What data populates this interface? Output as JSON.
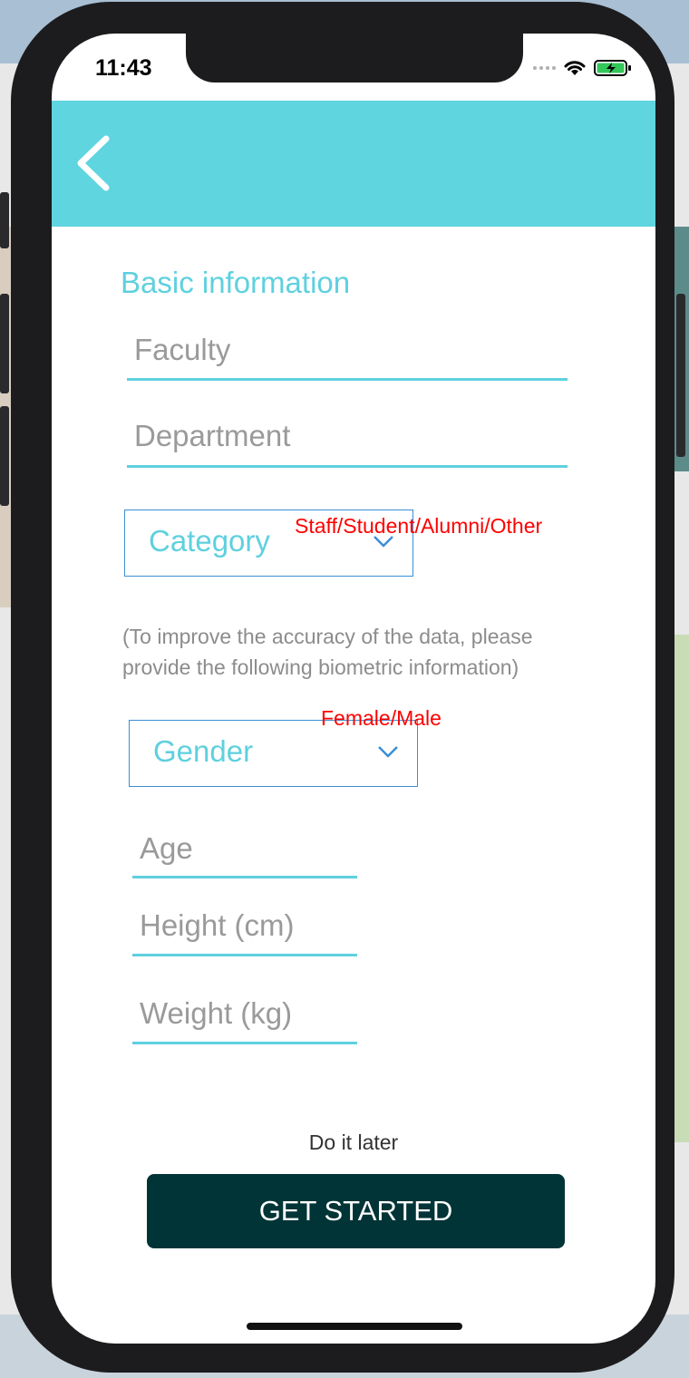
{
  "status_bar": {
    "time": "11:43"
  },
  "form": {
    "section_title": "Basic information",
    "faculty_placeholder": "Faculty",
    "department_placeholder": "Department",
    "category_label": "Category",
    "category_note": "Staff/Student/Alumni/Other",
    "biometric_note": "(To improve the accuracy of the data, please provide the following biometric information)",
    "gender_label": "Gender",
    "gender_note": "Female/Male",
    "age_placeholder": "Age",
    "height_placeholder": "Height (cm)",
    "weight_placeholder": "Weight (kg)"
  },
  "actions": {
    "later_label": "Do it later",
    "start_label": "GET STARTED"
  },
  "colors": {
    "accent": "#5fd5e0",
    "button": "#003436",
    "annotation": "#ff0000"
  },
  "icons": [
    "back-chevron-icon",
    "chevron-down-icon",
    "wifi-icon",
    "battery-icon",
    "signal-dots-icon"
  ]
}
